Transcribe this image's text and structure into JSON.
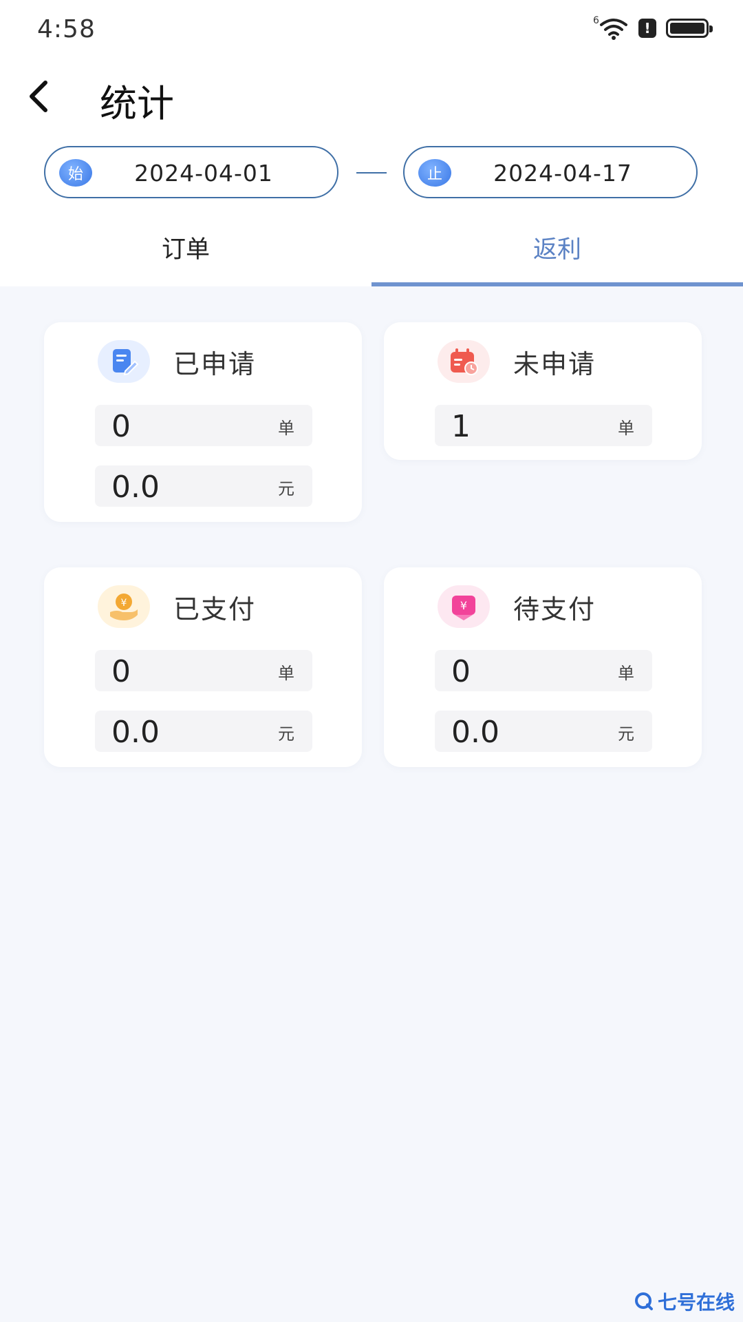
{
  "status_bar": {
    "time": "4:58",
    "network_label": "6",
    "alert_glyph": "!"
  },
  "header": {
    "title": "统计"
  },
  "date_range": {
    "start_badge": "始",
    "start_date": "2024-04-01",
    "end_badge": "止",
    "end_date": "2024-04-17"
  },
  "tabs": [
    {
      "label": "订单",
      "active": false
    },
    {
      "label": "返利",
      "active": true
    }
  ],
  "cards": {
    "applied": {
      "title": "已申请",
      "count": "0",
      "count_unit": "单",
      "amount": "0.0",
      "amount_unit": "元"
    },
    "not_applied": {
      "title": "未申请",
      "count": "1",
      "count_unit": "单"
    },
    "paid": {
      "title": "已支付",
      "count": "0",
      "count_unit": "单",
      "amount": "0.0",
      "amount_unit": "元"
    },
    "pending": {
      "title": "待支付",
      "count": "0",
      "count_unit": "单",
      "amount": "0.0",
      "amount_unit": "元"
    }
  },
  "icons": {
    "back": "chevron-left-icon",
    "applied": "edit-document-icon",
    "not_applied": "calendar-clock-icon",
    "paid": "hand-yuan-icon",
    "pending": "yuan-bill-icon"
  },
  "watermark": {
    "text": "七号在线"
  },
  "colors": {
    "accent": "#5b82c4",
    "tab_underline": "#6f93cf",
    "pill_border": "#3f6fa6",
    "background": "#f5f7fc"
  }
}
